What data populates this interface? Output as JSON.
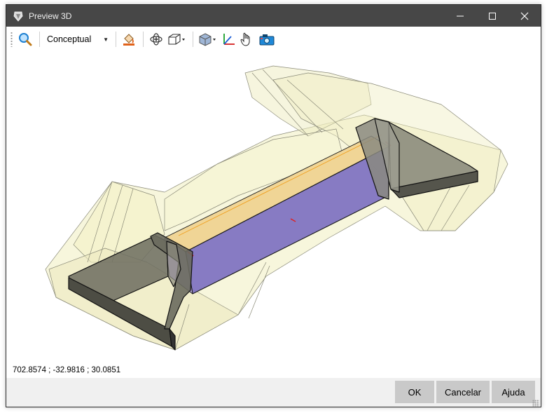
{
  "window": {
    "title": "Preview 3D"
  },
  "toolbar": {
    "render_mode": "Conceptual",
    "tools": [
      "zoom-icon",
      "paint-bucket-icon",
      "orbit-icon",
      "view-cube-icon",
      "shading-icon",
      "axes-icon",
      "pan-hand-icon",
      "camera-icon"
    ]
  },
  "viewport": {
    "coordinates": "702.8574 ; -32.9816 ; 30.0851"
  },
  "buttons": {
    "ok": "OK",
    "cancel": "Cancelar",
    "help": "Ajuda"
  },
  "colors": {
    "titlebar": "#474747",
    "beam_top": "#f0d596",
    "beam_side": "#7d70c0",
    "envelope": "#f1efc0",
    "abutment": "#6f6f62"
  }
}
